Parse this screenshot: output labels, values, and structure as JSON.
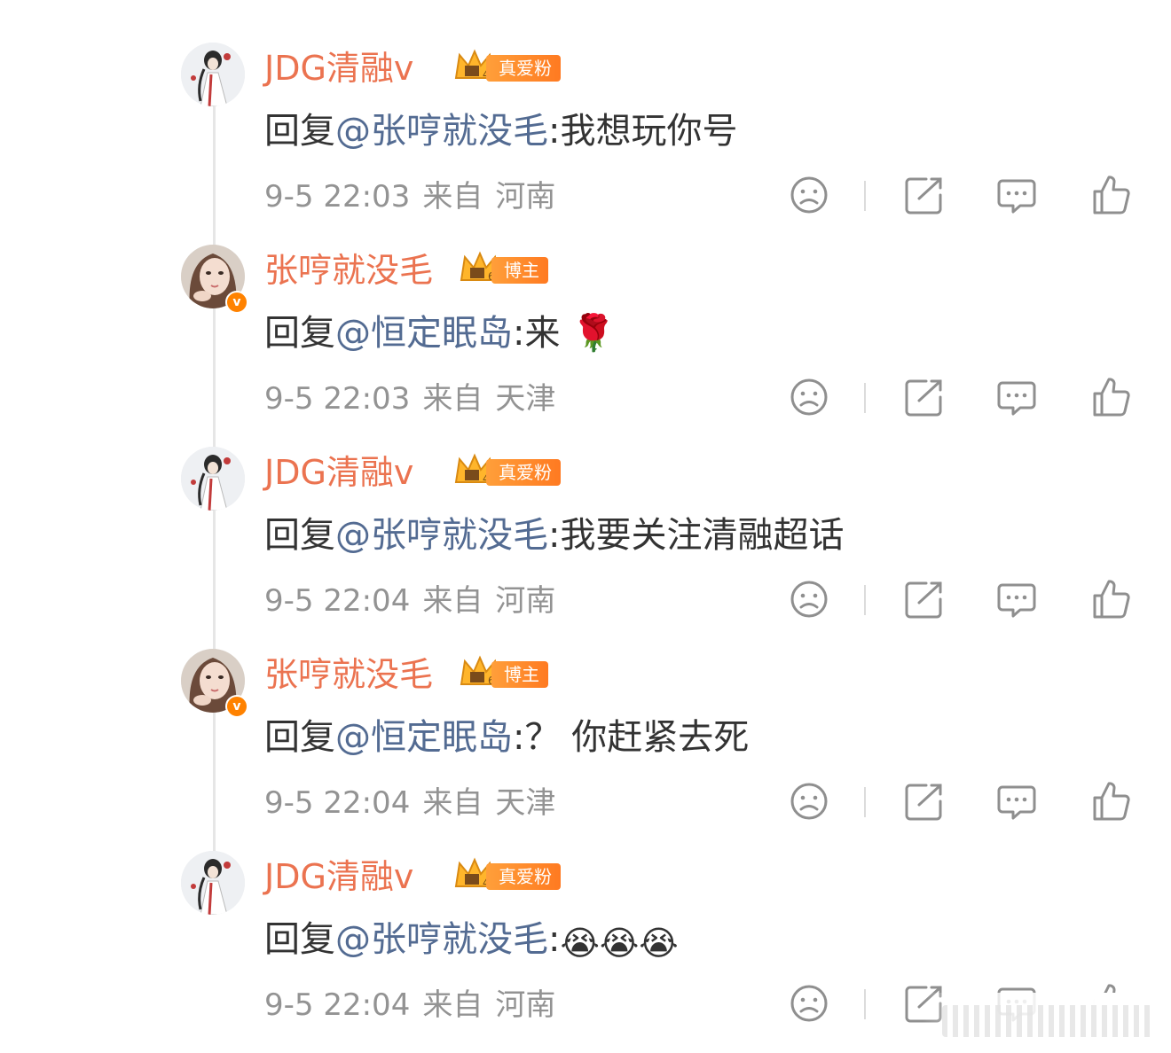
{
  "colors": {
    "username": "#eb7350",
    "mention": "#536b92",
    "text": "#333333",
    "meta": "#939393",
    "badge": "#ff8200"
  },
  "comments": [
    {
      "author": "JDG清融v",
      "badge": "真爱粉",
      "badge_level": "4",
      "reply_prefix": "回复",
      "mention": "@张哼就没毛",
      "colon": ":",
      "content": "我想玩你号",
      "time": "9-5 22:03",
      "from_label": "来自",
      "location": "河南"
    },
    {
      "author": "张哼就没毛",
      "badge": "博主",
      "badge_level": "6",
      "verified": true,
      "reply_prefix": "回复",
      "mention": "@恒定眠岛",
      "colon": ":",
      "content": "来 🌹",
      "time": "9-5 22:03",
      "from_label": "来自",
      "location": "天津"
    },
    {
      "author": "JDG清融v",
      "badge": "真爱粉",
      "badge_level": "4",
      "reply_prefix": "回复",
      "mention": "@张哼就没毛",
      "colon": ":",
      "content": "我要关注清融超话",
      "time": "9-5 22:04",
      "from_label": "来自",
      "location": "河南"
    },
    {
      "author": "张哼就没毛",
      "badge": "博主",
      "badge_level": "6",
      "verified": true,
      "reply_prefix": "回复",
      "mention": "@恒定眠岛",
      "colon": ":",
      "content": "？ 你赶紧去死",
      "time": "9-5 22:04",
      "from_label": "来自",
      "location": "天津"
    },
    {
      "author": "JDG清融v",
      "badge": "真爱粉",
      "badge_level": "4",
      "reply_prefix": "回复",
      "mention": "@张哼就没毛",
      "colon": ":",
      "content": "😭😭😭",
      "time": "9-5 22:04",
      "from_label": "来自",
      "location": "河南"
    }
  ],
  "action_icons": [
    "dislike-icon",
    "share-icon",
    "reply-icon",
    "like-icon"
  ]
}
